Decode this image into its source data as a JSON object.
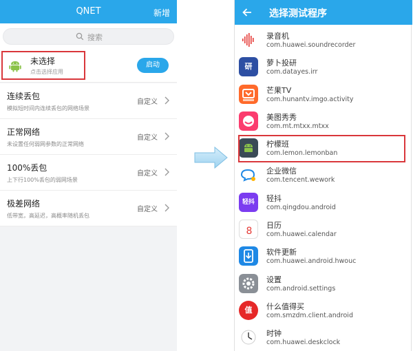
{
  "left": {
    "header": {
      "title": "QNET",
      "add_label": "新增"
    },
    "search": {
      "placeholder": "搜索"
    },
    "app": {
      "name": "未选择",
      "sub": "点击选择应用",
      "start_label": "启动"
    },
    "scenarios": [
      {
        "title": "连续丢包",
        "desc": "模拟短时间内连续丢包的网络场景",
        "action": "自定义"
      },
      {
        "title": "正常网络",
        "desc": "未设置任何弱网参数的正常网络",
        "action": "自定义"
      },
      {
        "title": "100%丢包",
        "desc": "上下行100%丢包的弱网场景",
        "action": "自定义"
      },
      {
        "title": "极差网络",
        "desc": "低带宽，高延迟，高概率随机丢包",
        "action": "自定义"
      }
    ]
  },
  "right": {
    "header": {
      "title": "选择测试程序"
    },
    "apps": [
      {
        "name": "录音机",
        "pkg": "com.huawei.soundrecorder",
        "icon": "waveform-icon",
        "color": "#ffffff"
      },
      {
        "name": "萝卜投研",
        "pkg": "com.datayes.irr",
        "icon": "datayes-logo-icon",
        "color": "#2d4fa3",
        "glyph": "研"
      },
      {
        "name": "芒果TV",
        "pkg": "com.hunantv.imgo.activity",
        "icon": "mangotv-logo-icon",
        "color": "#ff6a2b"
      },
      {
        "name": "美图秀秀",
        "pkg": "com.mt.mtxx.mtxx",
        "icon": "meitu-logo-icon",
        "color": "#fb3c6e"
      },
      {
        "name": "柠檬班",
        "pkg": "com.lemon.lemonban",
        "icon": "android-icon",
        "color": "#3a4a56"
      },
      {
        "name": "企业微信",
        "pkg": "com.tencent.wework",
        "icon": "wework-logo-icon",
        "color": "#ffffff"
      },
      {
        "name": "轻抖",
        "pkg": "com.qingdou.android",
        "icon": "qingdou-logo-icon",
        "color": "#7b3cf0",
        "glyph": "轻抖"
      },
      {
        "name": "日历",
        "pkg": "com.huawei.calendar",
        "icon": "calendar-icon",
        "color": "#ffffff",
        "glyph": "8"
      },
      {
        "name": "软件更新",
        "pkg": "com.huawei.android.hwouc",
        "icon": "update-icon",
        "color": "#1e88e5"
      },
      {
        "name": "设置",
        "pkg": "com.android.settings",
        "icon": "gear-icon",
        "color": "#8a8f96"
      },
      {
        "name": "什么值得买",
        "pkg": "com.smzdm.client.android",
        "icon": "smzdm-logo-icon",
        "color": "#e62828",
        "glyph": "值"
      },
      {
        "name": "时钟",
        "pkg": "com.huawei.deskclock",
        "icon": "clock-icon",
        "color": "#ffffff"
      }
    ]
  }
}
